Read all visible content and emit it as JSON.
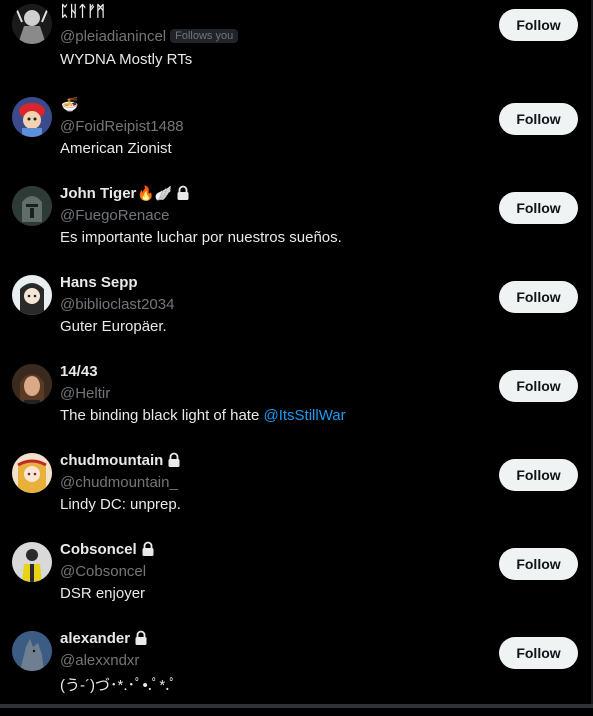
{
  "follow_label": "Follow",
  "follows_you_label": "Follows you",
  "users": [
    {
      "name": "ᛈᚺᛏᚠᛗ",
      "handle": "@pleiadianincel",
      "follows_you": true,
      "emoji": "",
      "locked": false,
      "bio": "WYDNA Mostly RTs",
      "avatar_icon": "dark-figure-avatar"
    },
    {
      "name": "",
      "emoji": "🍜",
      "handle": "@FoidReipist1488",
      "follows_you": false,
      "locked": false,
      "bio": "American Zionist",
      "avatar_icon": "red-cap-avatar"
    },
    {
      "name": "John Tiger",
      "emoji": "🔥🪽",
      "handle": "@FuegoRenace",
      "follows_you": false,
      "locked": true,
      "bio": "Es importante luchar por nuestros sueños.",
      "avatar_icon": "knight-avatar"
    },
    {
      "name": "Hans Sepp",
      "emoji": "",
      "handle": "@biblioclast2034",
      "follows_you": false,
      "locked": false,
      "bio": "Guter Europäer.",
      "avatar_icon": "anime-girl-avatar"
    },
    {
      "name": "14/43",
      "emoji": "",
      "handle": "@Heltir",
      "follows_you": false,
      "locked": false,
      "bio": "The binding black light of hate ",
      "bio_link": "@ItsStillWar",
      "avatar_icon": "man-portrait-avatar"
    },
    {
      "name": "chudmountain",
      "emoji": "",
      "handle": "@chudmountain_",
      "follows_you": false,
      "locked": true,
      "bio": "Lindy DC: unprep.",
      "avatar_icon": "anime-blonde-avatar"
    },
    {
      "name": "Cobsoncel",
      "emoji": "",
      "handle": "@Cobsoncel",
      "follows_you": false,
      "locked": true,
      "bio": "DSR enjoyer",
      "avatar_icon": "yellow-jacket-avatar"
    },
    {
      "name": "alexander",
      "emoji": "",
      "handle": "@alexxndxr",
      "follows_you": false,
      "locked": true,
      "bio": "(う-´)づ･*.･ﾟ•.ﾟ*.ﾟ",
      "avatar_icon": "wolf-avatar"
    }
  ],
  "colors": {
    "background": "#000000",
    "text": "#e7e9ea",
    "muted": "#71767b",
    "link": "#1d9bf0",
    "button_bg": "#eff3f4",
    "button_text": "#0f1419"
  }
}
